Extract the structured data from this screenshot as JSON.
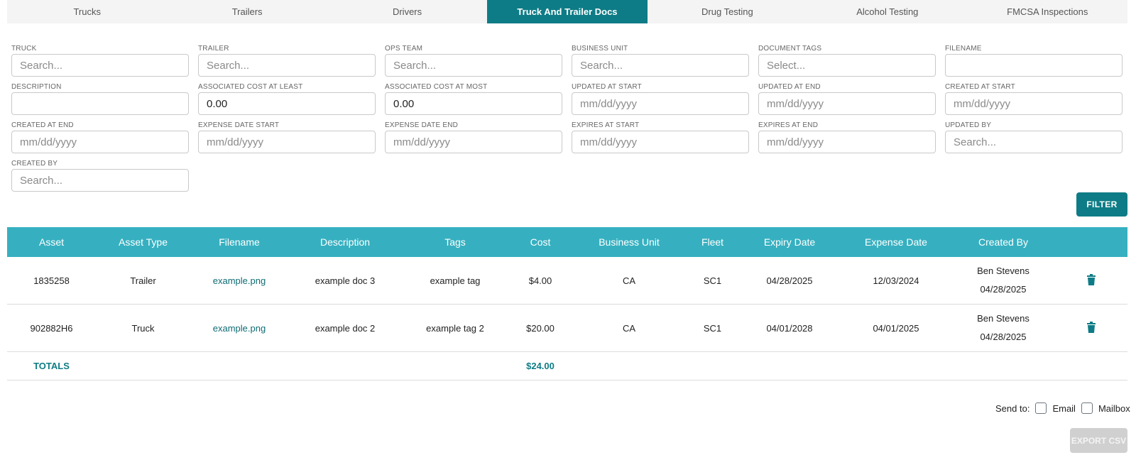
{
  "tabs": [
    {
      "label": "Trucks"
    },
    {
      "label": "Trailers"
    },
    {
      "label": "Drivers"
    },
    {
      "label": "Truck And Trailer Docs"
    },
    {
      "label": "Drug Testing"
    },
    {
      "label": "Alcohol Testing"
    },
    {
      "label": "FMCSA Inspections"
    }
  ],
  "active_tab": "Truck And Trailer Docs",
  "filters": [
    {
      "label": "TRUCK",
      "value": "",
      "placeholder": "Search..."
    },
    {
      "label": "TRAILER",
      "value": "",
      "placeholder": "Search..."
    },
    {
      "label": "OPS TEAM",
      "value": "",
      "placeholder": "Search..."
    },
    {
      "label": "BUSINESS UNIT",
      "value": "",
      "placeholder": "Search..."
    },
    {
      "label": "DOCUMENT TAGS",
      "value": "",
      "placeholder": "Select..."
    },
    {
      "label": "FILENAME",
      "value": "",
      "placeholder": ""
    },
    {
      "label": "DESCRIPTION",
      "value": "",
      "placeholder": ""
    },
    {
      "label": "ASSOCIATED COST AT LEAST",
      "value": "0.00",
      "placeholder": ""
    },
    {
      "label": "ASSOCIATED COST AT MOST",
      "value": "0.00",
      "placeholder": ""
    },
    {
      "label": "UPDATED AT START",
      "value": "",
      "placeholder": "mm/dd/yyyy"
    },
    {
      "label": "UPDATED AT END",
      "value": "",
      "placeholder": "mm/dd/yyyy"
    },
    {
      "label": "CREATED AT START",
      "value": "",
      "placeholder": "mm/dd/yyyy"
    },
    {
      "label": "CREATED AT END",
      "value": "",
      "placeholder": "mm/dd/yyyy"
    },
    {
      "label": "EXPENSE DATE START",
      "value": "",
      "placeholder": "mm/dd/yyyy"
    },
    {
      "label": "EXPENSE DATE END",
      "value": "",
      "placeholder": "mm/dd/yyyy"
    },
    {
      "label": "EXPIRES AT START",
      "value": "",
      "placeholder": "mm/dd/yyyy"
    },
    {
      "label": "EXPIRES AT END",
      "value": "",
      "placeholder": "mm/dd/yyyy"
    },
    {
      "label": "UPDATED BY",
      "value": "",
      "placeholder": "Search..."
    },
    {
      "label": "CREATED BY",
      "value": "",
      "placeholder": "Search..."
    }
  ],
  "filter_button": "FILTER",
  "table": {
    "columns": [
      "Asset",
      "Asset Type",
      "Filename",
      "Description",
      "Tags",
      "Cost",
      "Business Unit",
      "Fleet",
      "Expiry Date",
      "Expense Date",
      "Created By"
    ],
    "rows": [
      {
        "asset": "1835258",
        "asset_type": "Trailer",
        "filename": "example.png",
        "description": "example doc 3",
        "tags": "example tag",
        "cost": "$4.00",
        "business_unit": "CA",
        "fleet": "SC1",
        "expiry_date": "04/28/2025",
        "expense_date": "12/03/2024",
        "created_by": "Ben Stevens",
        "created_date": "04/28/2025",
        "delete_icon": "trash-icon"
      },
      {
        "asset": "902882H6",
        "asset_type": "Truck",
        "filename": "example.png",
        "description": "example doc 2",
        "tags": "example tag 2",
        "cost": "$20.00",
        "business_unit": "CA",
        "fleet": "SC1",
        "expiry_date": "04/01/2028",
        "expense_date": "04/01/2025",
        "created_by": "Ben Stevens",
        "created_date": "04/28/2025",
        "delete_icon": "trash-icon"
      }
    ],
    "totals_label": "TOTALS",
    "totals_cost": "$24.00"
  },
  "send_to": {
    "label": "Send to:",
    "options": [
      {
        "label": "Email",
        "checked": false
      },
      {
        "label": "Mailbox",
        "checked": false
      }
    ]
  },
  "export_button": "EXPORT CSV",
  "colors": {
    "primary": "#0e7c86",
    "header": "#36b0c0",
    "link": "#0e6b73",
    "disabled": "#d0d0d0"
  }
}
